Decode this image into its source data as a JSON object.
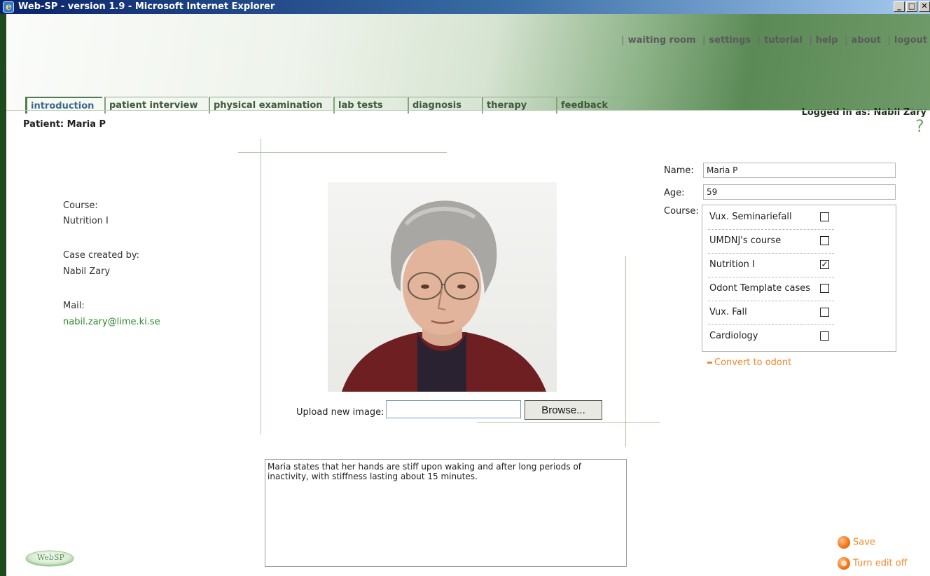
{
  "window": {
    "title": "Web-SP - version 1.9 - Microsoft Internet Explorer",
    "buttons": {
      "minimize": "_",
      "maximize": "□",
      "close": "✕"
    }
  },
  "toplinks": [
    "waiting room",
    "settings",
    "tutorial",
    "help",
    "about",
    "logout"
  ],
  "tabs": [
    {
      "label": "introduction",
      "active": true
    },
    {
      "label": "patient interview"
    },
    {
      "label": "physical examination"
    },
    {
      "label": "lab tests"
    },
    {
      "label": "diagnosis"
    },
    {
      "label": "therapy"
    },
    {
      "label": "feedback"
    }
  ],
  "logged_in": "Logged in as: Nabil Zary",
  "patient_title": "Patient: Maria P",
  "help_icon": "?",
  "info": {
    "course_label": "Course:",
    "course_value": "Nutrition I",
    "created_label": "Case created by:",
    "created_value": "Nabil Zary",
    "mail_label": "Mail:",
    "mail_value": "nabil.zary@lime.ki.se"
  },
  "upload": {
    "label": "Upload new image:",
    "value": "",
    "browse_label": "Browse..."
  },
  "description": "Maria states that her hands are stiff upon waking and after long periods of inactivity, with stiffness lasting about 15 minutes.",
  "form": {
    "name_label": "Name:",
    "name_value": "Maria P",
    "age_label": "Age:",
    "age_value": "59",
    "course_label": "Course:",
    "courses": [
      {
        "name": "Vux. Seminariefall",
        "checked": false
      },
      {
        "name": "UMDNJ's course",
        "checked": false
      },
      {
        "name": "Nutrition I",
        "checked": true
      },
      {
        "name": "Odont Template cases",
        "checked": false
      },
      {
        "name": "Vux. Fall",
        "checked": false
      },
      {
        "name": "Cardiology",
        "checked": false
      }
    ],
    "convert_link": "Convert to odont"
  },
  "actions": {
    "save": "Save",
    "edit_off": "Turn edit off"
  },
  "logo_text": "WebSP",
  "colors": {
    "accent_green": "#2a8a2a",
    "link_orange": "#f08a2a",
    "header_green": "#5b8a56"
  }
}
